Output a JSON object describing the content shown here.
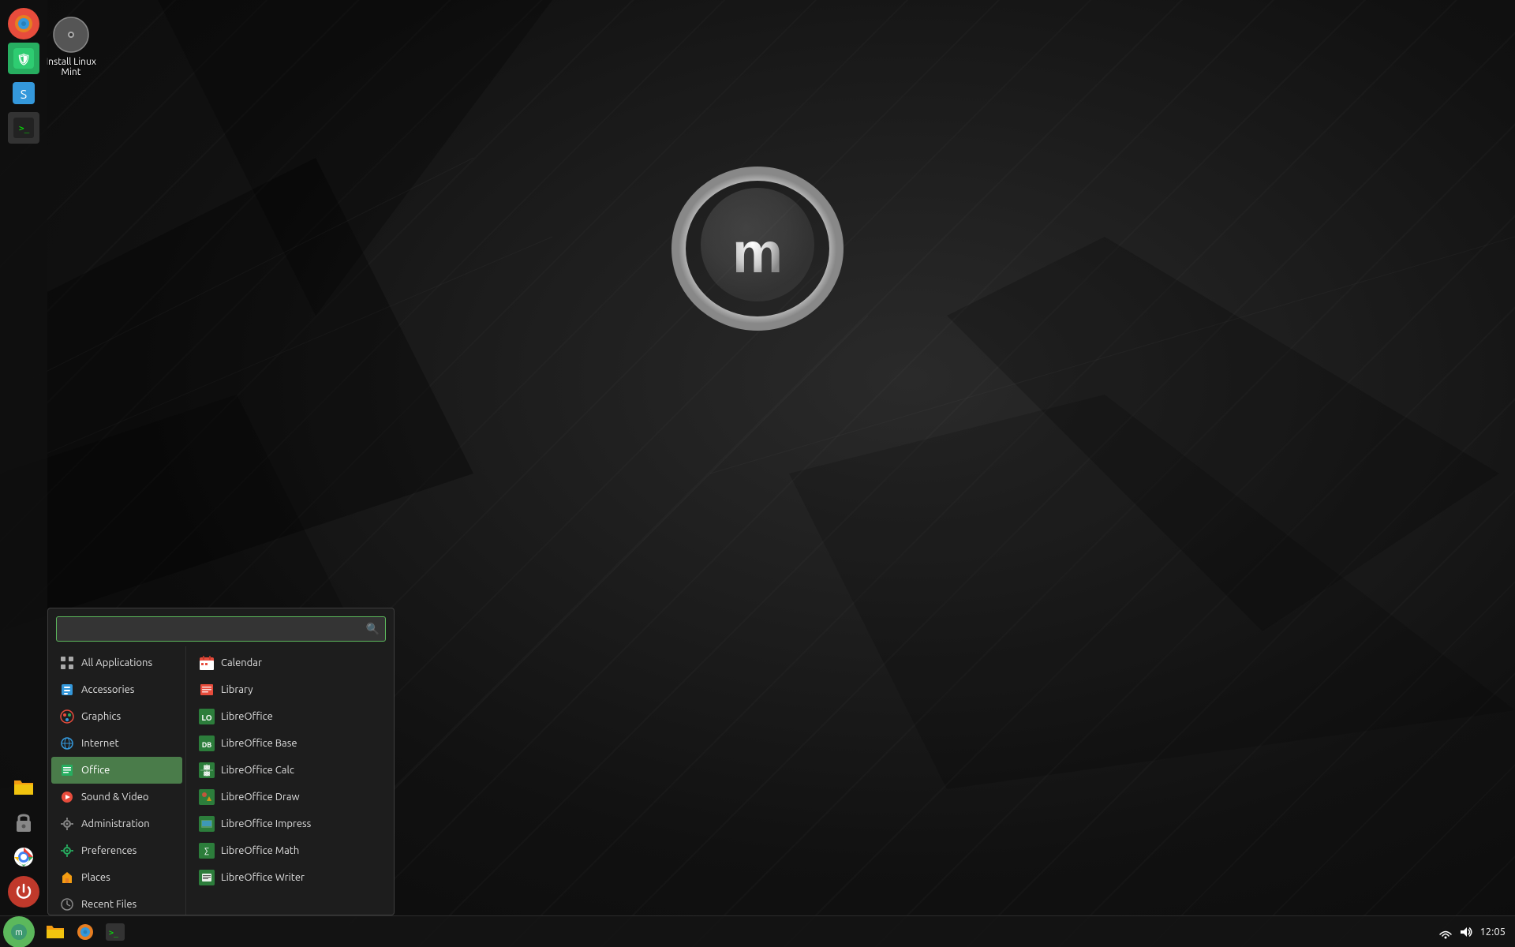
{
  "desktop": {
    "icon": {
      "label": "Install Linux Mint",
      "icon": "💿"
    }
  },
  "sidebar": {
    "icons": [
      {
        "name": "firefox-icon",
        "emoji": "🦊",
        "color": "#e74c3c"
      },
      {
        "name": "mint-update-icon",
        "emoji": "🛡️",
        "color": "#27ae60"
      },
      {
        "name": "synaptic-icon",
        "emoji": "📦",
        "color": "#3498db"
      },
      {
        "name": "terminal-icon",
        "emoji": "⬛",
        "color": "#555"
      },
      {
        "name": "files-icon",
        "emoji": "📁",
        "color": "#f39c12"
      },
      {
        "name": "lock-icon",
        "emoji": "🔒",
        "color": "#95a5a6"
      },
      {
        "name": "google-icon",
        "emoji": "G",
        "color": "#4285f4"
      },
      {
        "name": "power-icon",
        "emoji": "⏻",
        "color": "#e74c3c"
      }
    ]
  },
  "menu": {
    "search_placeholder": "",
    "categories": [
      {
        "name": "All Applications",
        "icon": "⊞",
        "active": false
      },
      {
        "name": "Accessories",
        "icon": "🔧",
        "active": false
      },
      {
        "name": "Graphics",
        "icon": "🎨",
        "active": false
      },
      {
        "name": "Internet",
        "icon": "🌐",
        "active": false
      },
      {
        "name": "Office",
        "icon": "📄",
        "active": true
      },
      {
        "name": "Sound & Video",
        "icon": "🎵",
        "active": false
      },
      {
        "name": "Administration",
        "icon": "⚙️",
        "active": false
      },
      {
        "name": "Preferences",
        "icon": "🔧",
        "active": false
      },
      {
        "name": "Places",
        "icon": "📁",
        "active": false
      },
      {
        "name": "Recent Files",
        "icon": "🕒",
        "active": false
      }
    ],
    "apps": [
      {
        "name": "Calendar",
        "icon": "📅",
        "color": "red"
      },
      {
        "name": "Library",
        "icon": "📚",
        "color": "red"
      },
      {
        "name": "LibreOffice",
        "icon": "LO",
        "color": "lo"
      },
      {
        "name": "LibreOffice Base",
        "icon": "LB",
        "color": "lo"
      },
      {
        "name": "LibreOffice Calc",
        "icon": "LC",
        "color": "lo"
      },
      {
        "name": "LibreOffice Draw",
        "icon": "LD",
        "color": "lo"
      },
      {
        "name": "LibreOffice Impress",
        "icon": "LI",
        "color": "lo"
      },
      {
        "name": "LibreOffice Math",
        "icon": "LM",
        "color": "lo"
      },
      {
        "name": "LibreOffice Writer",
        "icon": "LW",
        "color": "lo"
      }
    ]
  },
  "taskbar": {
    "start_icon": "🌿",
    "apps": [
      {
        "name": "file-manager-taskbar",
        "emoji": "📁",
        "color": "#f39c12"
      },
      {
        "name": "firefox-taskbar",
        "emoji": "🦊",
        "color": "#e74c3c"
      },
      {
        "name": "terminal-taskbar",
        "emoji": "⬛",
        "color": "#555"
      }
    ],
    "time": "12:05",
    "network_icon": "📶",
    "volume_icon": "🔊"
  }
}
